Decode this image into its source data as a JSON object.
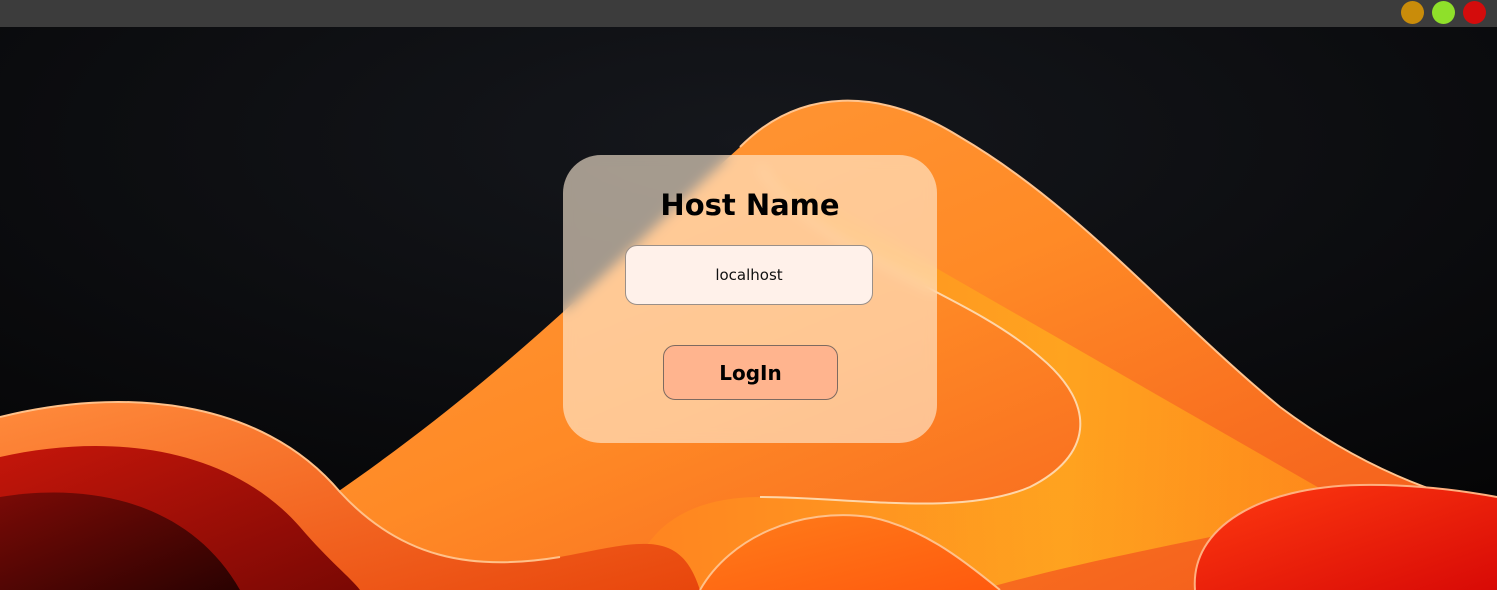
{
  "window": {
    "controls": [
      {
        "name": "minimize",
        "color": "#c98c0a"
      },
      {
        "name": "maximize",
        "color": "#8fe02a"
      },
      {
        "name": "close",
        "color": "#d40c0c"
      }
    ]
  },
  "login_card": {
    "title": "Host Name",
    "host_input_value": "localhost",
    "login_label": "LogIn"
  },
  "colors": {
    "background": "#0b0c0f",
    "wave_orange": "#ff8c2a",
    "wave_red": "#e01a0a",
    "card_glass": "#ffeed7",
    "button_fill": "#ffb48e"
  }
}
